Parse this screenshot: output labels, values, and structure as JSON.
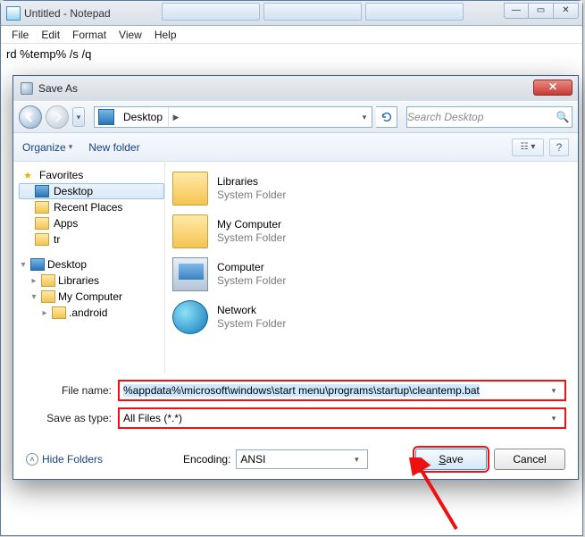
{
  "notepad": {
    "title": "Untitled - Notepad",
    "menu": {
      "file": "File",
      "edit": "Edit",
      "format": "Format",
      "view": "View",
      "help": "Help"
    },
    "content": "rd %temp% /s /q"
  },
  "saveas": {
    "title": "Save As",
    "breadcrumb": {
      "location": "Desktop"
    },
    "search_placeholder": "Search Desktop",
    "toolbar": {
      "organize": "Organize",
      "newfolder": "New folder"
    },
    "nav": {
      "favorites": "Favorites",
      "fav_items": [
        "Desktop",
        "Recent Places",
        "Apps",
        "tr"
      ],
      "desktop": "Desktop",
      "tree": [
        "Libraries",
        "My Computer",
        ".android"
      ]
    },
    "list": [
      {
        "name": "Libraries",
        "sub": "System Folder"
      },
      {
        "name": "My Computer",
        "sub": "System Folder"
      },
      {
        "name": "Computer",
        "sub": "System Folder"
      },
      {
        "name": "Network",
        "sub": "System Folder"
      }
    ],
    "form": {
      "filename_label": "File name:",
      "filename_value": "%appdata%\\microsoft\\windows\\start menu\\programs\\startup\\cleantemp.bat",
      "type_label": "Save as type:",
      "type_value": "All Files (*.*)",
      "encoding_label": "Encoding:",
      "encoding_value": "ANSI",
      "hide_folders": "Hide Folders",
      "save": "Save",
      "cancel": "Cancel"
    }
  }
}
